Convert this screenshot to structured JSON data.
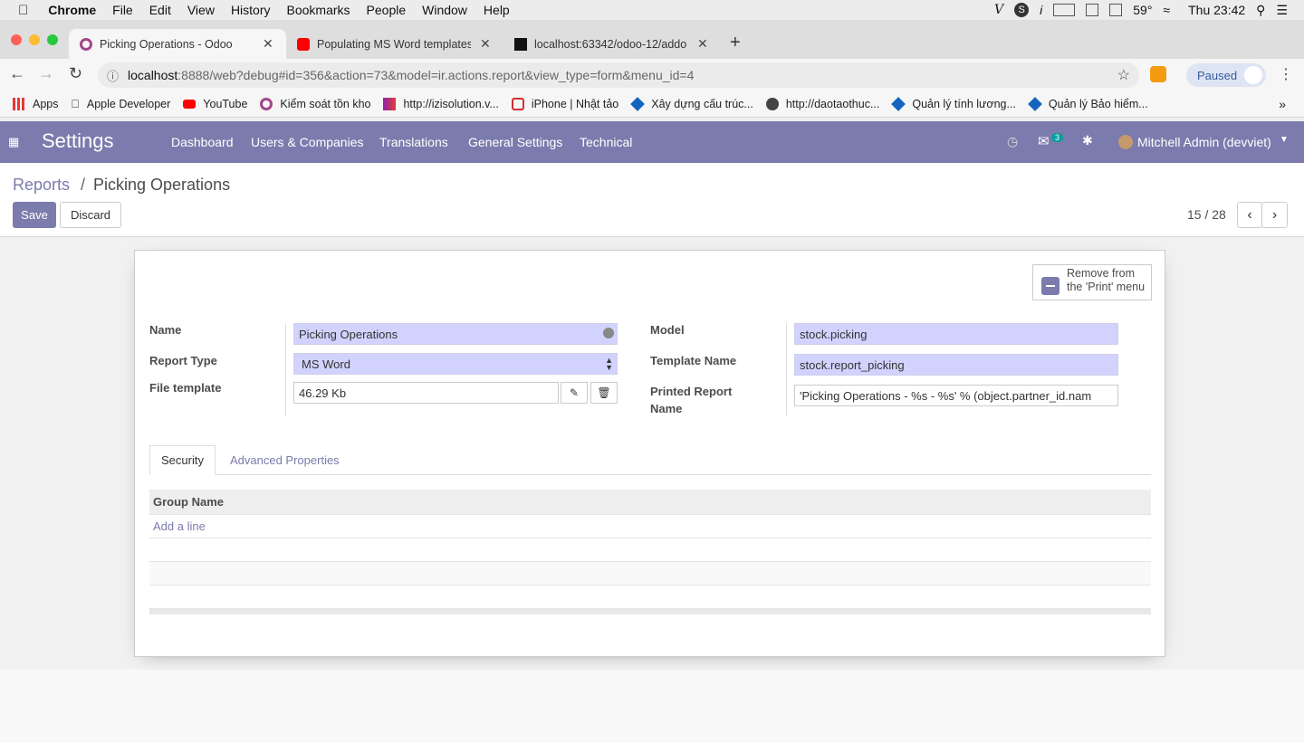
{
  "mac_menu": {
    "app": "Chrome",
    "items": [
      "File",
      "Edit",
      "View",
      "History",
      "Bookmarks",
      "People",
      "Window",
      "Help"
    ]
  },
  "mac_status": {
    "temp": "59°",
    "clock": "Thu 23:42"
  },
  "browser_tabs": [
    {
      "title": "Picking Operations - Odoo",
      "active": true
    },
    {
      "title": "Populating MS Word templates",
      "active": false
    },
    {
      "title": "localhost:63342/odoo-12/addo",
      "active": false
    }
  ],
  "url": {
    "host": "localhost",
    "rest": ":8888/web?debug#id=356&action=73&model=ir.actions.report&view_type=form&menu_id=4"
  },
  "profile_status": "Paused",
  "bookmarks": [
    "Apps",
    "Apple Developer",
    "YouTube",
    "Kiểm soát tồn kho",
    "http://izisolution.v...",
    "iPhone | Nhật tảo",
    "Xây dựng cấu trúc...",
    "http://daotaothuc...",
    "Quản lý tính lương...",
    "Quản lý Bảo hiểm..."
  ],
  "odoo": {
    "brand": "Settings",
    "menu": [
      "Dashboard",
      "Users & Companies",
      "Translations",
      "General Settings",
      "Technical"
    ],
    "chat_count": "3",
    "user": "Mitchell Admin (devviet)"
  },
  "breadcrumb": {
    "parent": "Reports",
    "sep": "/",
    "current": "Picking Operations"
  },
  "buttons": {
    "save": "Save",
    "discard": "Discard"
  },
  "pager": "15 / 28",
  "remove_print": "Remove from the 'Print' menu",
  "form": {
    "name_label": "Name",
    "name_value": "Picking Operations",
    "report_type_label": "Report Type",
    "report_type_value": "MS Word",
    "file_template_label": "File template",
    "file_template_value": "46.29 Kb",
    "model_label": "Model",
    "model_value": "stock.picking",
    "template_name_label": "Template Name",
    "template_name_value": "stock.report_picking",
    "printed_label_1": "Printed Report",
    "printed_label_2": "Name",
    "printed_value": "'Picking Operations - %s - %s' % (object.partner_id.nam"
  },
  "tabs": [
    "Security",
    "Advanced Properties"
  ],
  "table": {
    "header": "Group Name",
    "add_line": "Add a line"
  },
  "colors": {
    "odoo_primary": "#7c7bad",
    "required_field": "#d2d2ff"
  }
}
